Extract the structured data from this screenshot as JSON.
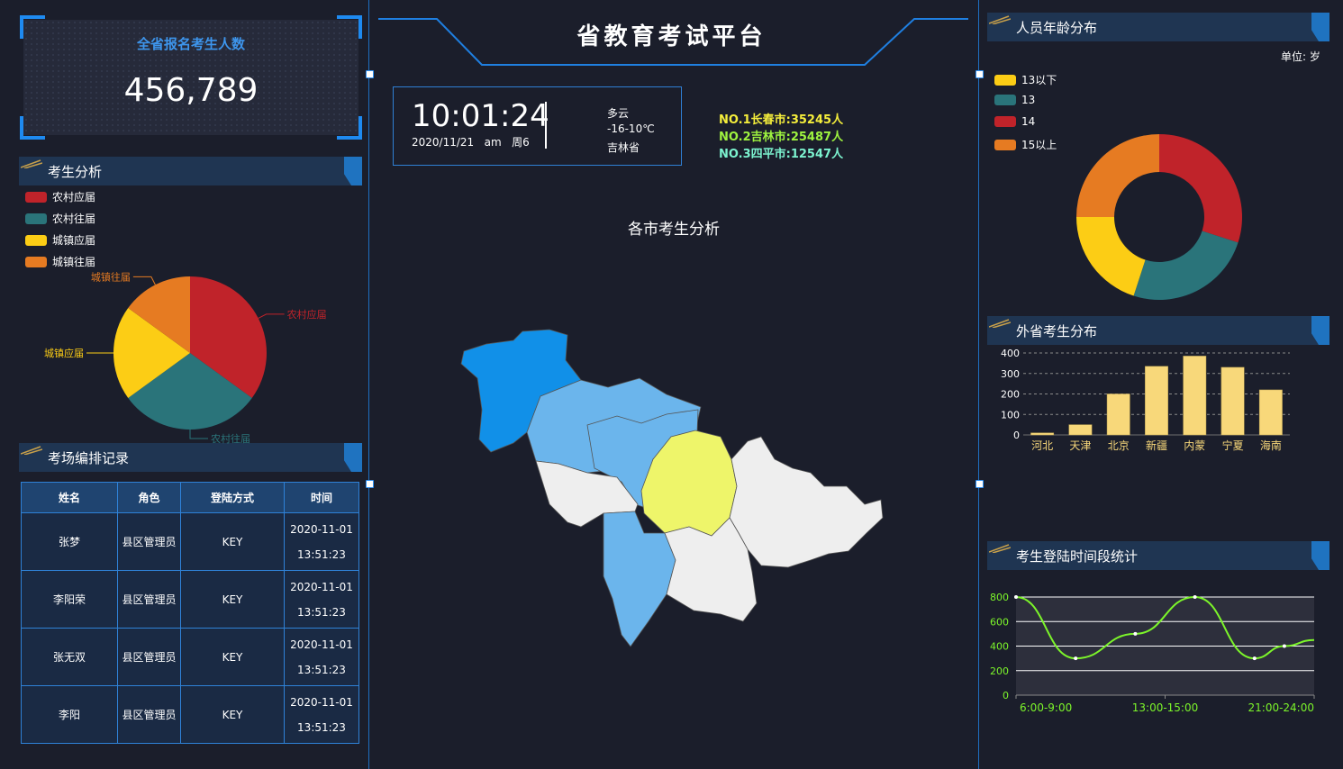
{
  "header": {
    "title": "省教育考试平台"
  },
  "total": {
    "label": "全省报名考生人数",
    "value": "456,789"
  },
  "clock": {
    "time": "10:01:24",
    "date": "2020/11/21",
    "ampm": "am",
    "weekday": "周6"
  },
  "weather": {
    "condition": "多云",
    "temp": "-16-10℃",
    "province": "吉林省"
  },
  "ranking": [
    {
      "label": "NO.1长春市:",
      "value": "35245人",
      "color": "#f5ee3b"
    },
    {
      "label": "NO.2吉林市:",
      "value": "25487人",
      "color": "#9ef33f"
    },
    {
      "label": "NO.3四平市:",
      "value": "12547人",
      "color": "#7cf3cf"
    }
  ],
  "map": {
    "title": "各市考生分析"
  },
  "student_analysis": {
    "title": "考生分析",
    "legend": [
      "农村应届",
      "农村往届",
      "城镇应届",
      "城镇往届"
    ]
  },
  "exam_records": {
    "title": "考场编排记录",
    "columns": [
      "姓名",
      "角色",
      "登陆方式",
      "时间"
    ],
    "rows": [
      {
        "name": "张梦",
        "role": "县区管理员",
        "login": "KEY",
        "date": "2020-11-01",
        "time": "13:51:23"
      },
      {
        "name": "李阳荣",
        "role": "县区管理员",
        "login": "KEY",
        "date": "2020-11-01",
        "time": "13:51:23"
      },
      {
        "name": "张无双",
        "role": "县区管理员",
        "login": "KEY",
        "date": "2020-11-01",
        "time": "13:51:23"
      },
      {
        "name": "李阳",
        "role": "县区管理员",
        "login": "KEY",
        "date": "2020-11-01",
        "time": "13:51:23"
      }
    ]
  },
  "age_distribution": {
    "title": "人员年龄分布",
    "unit": "单位: 岁",
    "legend": [
      "13以下",
      "13",
      "14",
      "15以上"
    ]
  },
  "out_province": {
    "title": "外省考生分布"
  },
  "login_time": {
    "title": "考生登陆时间段统计"
  },
  "colors": {
    "red": "#c0232a",
    "teal": "#2a747a",
    "yellow": "#fccd15",
    "orange": "#e67b22",
    "accent": "#1f73c0"
  },
  "chart_data": [
    {
      "type": "pie",
      "name": "考生分析",
      "categories": [
        "农村应届",
        "农村往届",
        "城镇应届",
        "城镇往届"
      ],
      "values": [
        35,
        30,
        20,
        15
      ],
      "colors": [
        "#c0232a",
        "#2a747a",
        "#fccd15",
        "#e67b22"
      ]
    },
    {
      "type": "pie",
      "name": "人员年龄分布",
      "donut": true,
      "categories": [
        "13以下",
        "13",
        "14",
        "15以上"
      ],
      "values": [
        20,
        25,
        30,
        25
      ],
      "slice_order": [
        "14",
        "13",
        "13以下",
        "15以上"
      ],
      "colors": {
        "13以下": "#fccd15",
        "13": "#2a747a",
        "14": "#c0232a",
        "15以上": "#e67b22"
      }
    },
    {
      "type": "bar",
      "name": "外省考生分布",
      "categories": [
        "河北",
        "天津",
        "北京",
        "新疆",
        "内蒙",
        "宁夏",
        "海南"
      ],
      "values": [
        10,
        50,
        200,
        335,
        385,
        330,
        220
      ],
      "ylim": [
        0,
        400
      ],
      "yticks": [
        0,
        100,
        200,
        300,
        400
      ],
      "grid": true,
      "color": "#f8d87a"
    },
    {
      "type": "line",
      "name": "考生登陆时间段统计",
      "x": [
        0,
        1,
        2,
        3,
        4,
        5,
        6
      ],
      "values": [
        800,
        300,
        500,
        800,
        300,
        400
      ],
      "points_x": [
        0,
        1,
        2,
        3,
        4,
        4.5
      ],
      "xtick_labels": [
        "6:00-9:00",
        "13:00-15:00",
        "21:00-24:00"
      ],
      "ylim": [
        0,
        800
      ],
      "yticks": [
        0,
        200,
        400,
        600,
        800
      ],
      "color": "#7cf52a"
    }
  ]
}
